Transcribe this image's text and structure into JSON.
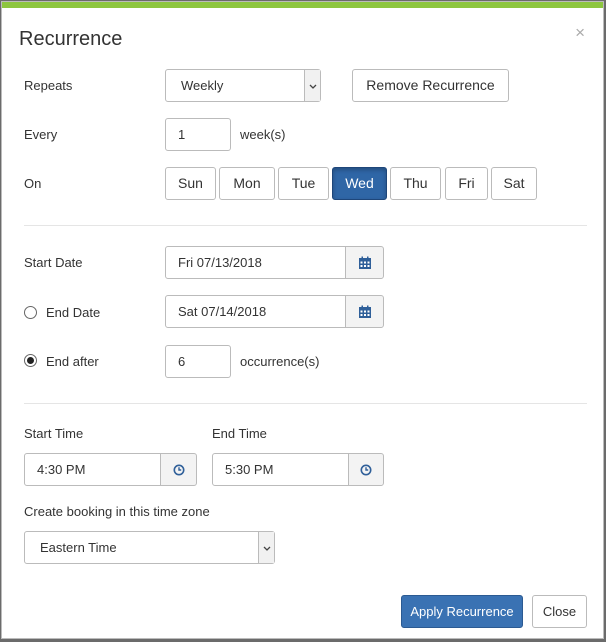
{
  "dialog": {
    "title": "Recurrence",
    "close_glyph": "×"
  },
  "repeats": {
    "label": "Repeats",
    "value": "Weekly",
    "remove_label": "Remove Recurrence"
  },
  "every": {
    "label": "Every",
    "value": "1",
    "unit": "week(s)"
  },
  "on": {
    "label": "On",
    "days": [
      "Sun",
      "Mon",
      "Tue",
      "Wed",
      "Thu",
      "Fri",
      "Sat"
    ],
    "selected": "Wed"
  },
  "start_date": {
    "label": "Start Date",
    "value": "Fri 07/13/2018",
    "icon": "calendar-icon"
  },
  "end_date": {
    "label": "End Date",
    "value": "Sat 07/14/2018",
    "checked": false,
    "icon": "calendar-icon"
  },
  "end_after": {
    "label": "End after",
    "value": "6",
    "unit": "occurrence(s)",
    "checked": true
  },
  "start_time": {
    "label": "Start Time",
    "value": "4:30 PM",
    "icon": "clock-icon"
  },
  "end_time": {
    "label": "End Time",
    "value": "5:30 PM",
    "icon": "clock-icon"
  },
  "timezone": {
    "label": "Create booking in this time zone",
    "value": "Eastern Time"
  },
  "footer": {
    "apply_label": "Apply Recurrence",
    "close_label": "Close"
  },
  "colors": {
    "accent": "#8dc63f",
    "primary": "#3a72b3",
    "selected_day": "#2f66a6"
  }
}
